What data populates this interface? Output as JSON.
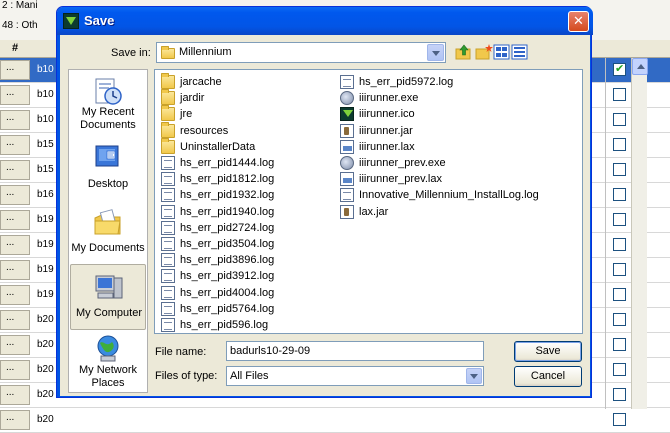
{
  "background": {
    "top_rows": [
      "2 : Mani",
      "48 : Oth"
    ],
    "header_hash": "#",
    "rows": [
      {
        "dots": "...",
        "cell": "b10",
        "checked": true,
        "selected": true
      },
      {
        "dots": "...",
        "cell": "b10",
        "checked": false,
        "selected": false
      },
      {
        "dots": "...",
        "cell": "b10",
        "checked": false,
        "selected": false
      },
      {
        "dots": "...",
        "cell": "b15",
        "checked": false,
        "selected": false
      },
      {
        "dots": "...",
        "cell": "b15",
        "checked": false,
        "selected": false
      },
      {
        "dots": "...",
        "cell": "b16",
        "checked": false,
        "selected": false
      },
      {
        "dots": "...",
        "cell": "b19",
        "checked": false,
        "selected": false
      },
      {
        "dots": "...",
        "cell": "b19",
        "checked": false,
        "selected": false
      },
      {
        "dots": "...",
        "cell": "b19",
        "checked": false,
        "selected": false
      },
      {
        "dots": "...",
        "cell": "b19",
        "checked": false,
        "selected": false
      },
      {
        "dots": "...",
        "cell": "b20",
        "checked": false,
        "selected": false
      },
      {
        "dots": "...",
        "cell": "b20",
        "checked": false,
        "selected": false
      },
      {
        "dots": "...",
        "cell": "b20",
        "checked": false,
        "selected": false
      },
      {
        "dots": "...",
        "cell": "b20",
        "checked": false,
        "selected": false
      },
      {
        "dots": "...",
        "cell": "b20",
        "checked": false,
        "selected": false
      }
    ]
  },
  "dialog": {
    "title": "Save",
    "close_glyph": "✕",
    "save_in_label": "Save in:",
    "save_in_value": "Millennium",
    "places": [
      {
        "name": "place-my-recent-documents",
        "icon": "recent-documents-icon",
        "label": "My Recent Documents"
      },
      {
        "name": "place-desktop",
        "icon": "desktop-icon",
        "label": "Desktop"
      },
      {
        "name": "place-my-documents",
        "icon": "my-documents-icon",
        "label": "My Documents"
      },
      {
        "name": "place-my-computer",
        "icon": "my-computer-icon",
        "label": "My Computer",
        "active": true
      },
      {
        "name": "place-my-network-places",
        "icon": "network-places-icon",
        "label": "My Network Places"
      }
    ],
    "files_col1": [
      {
        "name": "jarcache",
        "icon": "folder"
      },
      {
        "name": "jardir",
        "icon": "folder"
      },
      {
        "name": "jre",
        "icon": "folder"
      },
      {
        "name": "resources",
        "icon": "folder"
      },
      {
        "name": "UninstallerData",
        "icon": "folder"
      },
      {
        "name": "hs_err_pid1444.log",
        "icon": "log"
      },
      {
        "name": "hs_err_pid1812.log",
        "icon": "log"
      },
      {
        "name": "hs_err_pid1932.log",
        "icon": "log"
      },
      {
        "name": "hs_err_pid1940.log",
        "icon": "log"
      },
      {
        "name": "hs_err_pid2724.log",
        "icon": "log"
      },
      {
        "name": "hs_err_pid3504.log",
        "icon": "log"
      },
      {
        "name": "hs_err_pid3896.log",
        "icon": "log"
      },
      {
        "name": "hs_err_pid3912.log",
        "icon": "log"
      },
      {
        "name": "hs_err_pid4004.log",
        "icon": "log"
      },
      {
        "name": "hs_err_pid5764.log",
        "icon": "log"
      },
      {
        "name": "hs_err_pid596.log",
        "icon": "log"
      }
    ],
    "files_col2": [
      {
        "name": "hs_err_pid5972.log",
        "icon": "log"
      },
      {
        "name": "iiirunner.exe",
        "icon": "exe"
      },
      {
        "name": "iiirunner.ico",
        "icon": "ico"
      },
      {
        "name": "iiirunner.jar",
        "icon": "jar"
      },
      {
        "name": "iiirunner.lax",
        "icon": "lax"
      },
      {
        "name": "iiirunner_prev.exe",
        "icon": "exe"
      },
      {
        "name": "iiirunner_prev.lax",
        "icon": "lax"
      },
      {
        "name": "Innovative_Millennium_InstallLog.log",
        "icon": "log"
      },
      {
        "name": "lax.jar",
        "icon": "jar"
      }
    ],
    "file_name_label": "File name:",
    "file_name_value": "badurls10-29-09",
    "file_type_label": "Files of type:",
    "file_type_value": "All Files",
    "save_button": "Save",
    "cancel_button": "Cancel"
  }
}
